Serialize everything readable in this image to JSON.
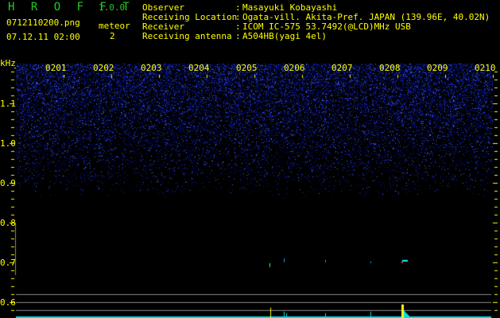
{
  "header": {
    "app_title": "H R O F F T",
    "version": "1.0.0",
    "filename": "0712110200.png",
    "datetime": "07.12.11 02:00",
    "meteor_label": "meteor",
    "meteor_count": "2"
  },
  "info": [
    {
      "label": "Observer",
      "value": "Masayuki Kobayashi"
    },
    {
      "label": "Receiving Location",
      "value": "Ogata-vill. Akita-Pref. JAPAN (139.96E, 40.02N)"
    },
    {
      "label": "Receiver",
      "value": "ICOM IC-575 53.7492(@LCD)MHz USB"
    },
    {
      "label": "Receiving antenna",
      "value": "A504HB(yagi 4el)"
    }
  ],
  "axis": {
    "unit": "kHz",
    "y_ticks": [
      "1.1",
      "1.0",
      "0.9",
      "0.8",
      "0.7",
      "0.6"
    ],
    "x_ticks": [
      "0201",
      "0202",
      "0203",
      "0204",
      "0205",
      "0206",
      "0207",
      "0208",
      "0209",
      "0210"
    ]
  },
  "colors": {
    "text": "#ffff00",
    "title": "#22cc22",
    "noise": "#2233ff",
    "baseline": "#00e0e0"
  }
}
